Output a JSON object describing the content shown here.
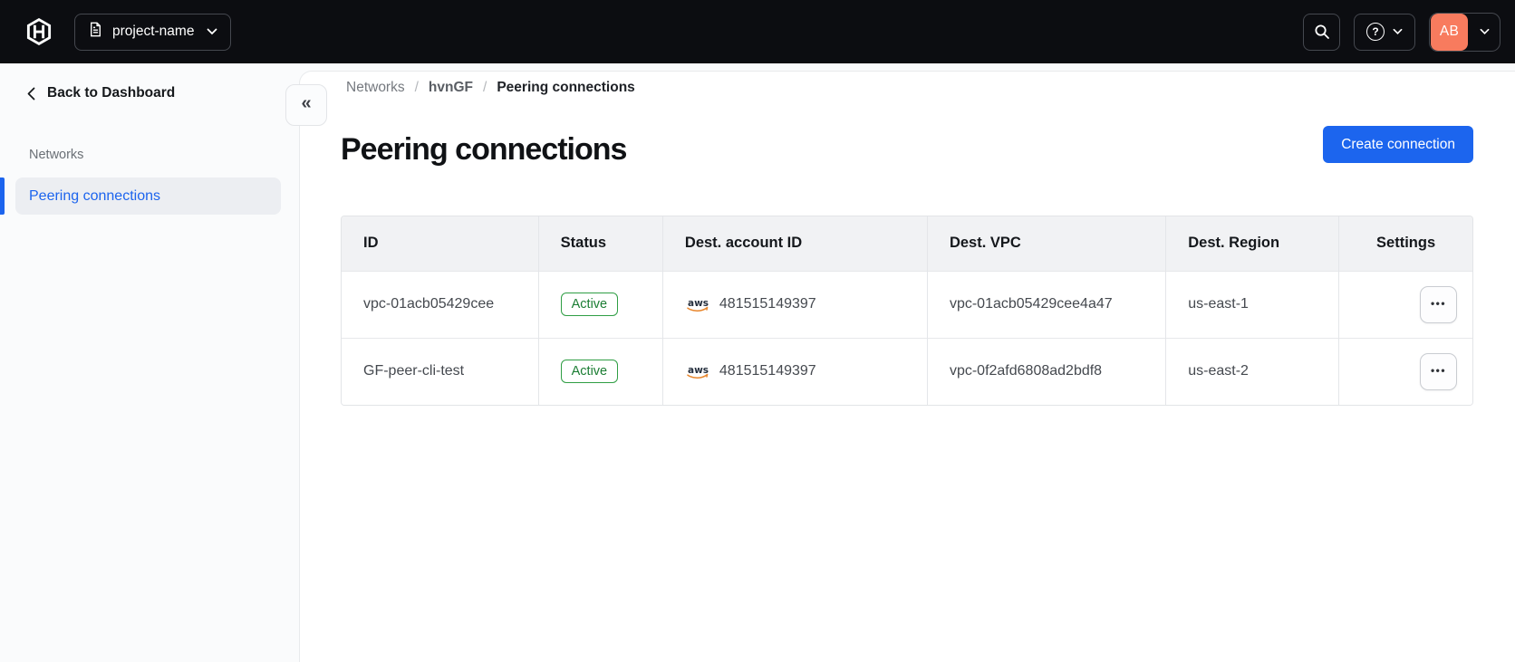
{
  "topbar": {
    "project_switcher": {
      "label": "project-name"
    },
    "user_menu": {
      "initials": "AB"
    }
  },
  "sidebar": {
    "back_label": "Back to Dashboard",
    "section_label": "Networks",
    "items": [
      {
        "label": "Peering connections",
        "active": true
      }
    ]
  },
  "breadcrumb": {
    "items": [
      "Networks",
      "hvnGF",
      "Peering connections"
    ],
    "separator": "/"
  },
  "page": {
    "title": "Peering connections",
    "create_button_label": "Create connection"
  },
  "table": {
    "columns": [
      "ID",
      "Status",
      "Dest. account ID",
      "Dest. VPC",
      "Dest. Region",
      "Settings"
    ],
    "rows": [
      {
        "id": "vpc-01acb05429cee",
        "status": "Active",
        "account_id": "481515149397",
        "vpc": "vpc-01acb05429cee4a47",
        "region": "us-east-1"
      },
      {
        "id": "GF-peer-cli-test",
        "status": "Active",
        "account_id": "481515149397",
        "vpc": "vpc-0f2afd6808ad2bdf8",
        "region": "us-east-2"
      }
    ]
  },
  "icons": {
    "help_glyph": "?",
    "collapse_glyph": "«",
    "ellipsis_glyph": "•••",
    "aws_label": "aws"
  },
  "colors": {
    "topbar_bg": "#0c0d11",
    "accent_blue": "#1c64ee",
    "badge_green_border": "#2f9e44",
    "badge_green_text": "#1b7d33",
    "avatar_bg": "#f87b5e",
    "sidebar_bg": "#fafbfc",
    "header_row_bg": "#f1f2f4"
  }
}
